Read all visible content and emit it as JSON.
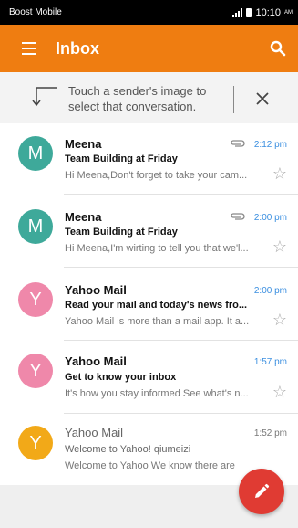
{
  "status_bar": {
    "carrier": "Boost Mobile",
    "time": "10:10",
    "ampm": "AM"
  },
  "app_bar": {
    "title": "Inbox"
  },
  "tip": {
    "text": "Touch a sender's image to select that conversation."
  },
  "colors": {
    "accent": "#ef7d11",
    "fab": "#e03b33",
    "unread_time": "#3b8fe0"
  },
  "messages": [
    {
      "initial": "M",
      "avatar_color": "#3ea99a",
      "sender": "Meena",
      "subject": "Team Building at Friday",
      "preview": "Hi Meena,Don't forget to take your cam...",
      "time": "2:12 pm",
      "attachment": true,
      "read": false
    },
    {
      "initial": "M",
      "avatar_color": "#3ea99a",
      "sender": "Meena",
      "subject": "Team Building at Friday",
      "preview": "Hi Meena,I'm wirting to tell you that we'l...",
      "time": "2:00 pm",
      "attachment": true,
      "read": false
    },
    {
      "initial": "Y",
      "avatar_color": "#ef88aa",
      "sender": "Yahoo Mail",
      "subject": "Read your mail and today's news fro...",
      "preview": "Yahoo Mail is more than a mail app. It a...",
      "time": "2:00 pm",
      "attachment": false,
      "read": false
    },
    {
      "initial": "Y",
      "avatar_color": "#ef88aa",
      "sender": "Yahoo Mail",
      "subject": "Get to know your inbox",
      "preview": "It's how you stay informed See what's n...",
      "time": "1:57 pm",
      "attachment": false,
      "read": false
    },
    {
      "initial": "Y",
      "avatar_color": "#f2a918",
      "sender": "Yahoo Mail",
      "subject": "Welcome to Yahoo! qiumeizi",
      "preview": "Welcome to Yahoo We know there are",
      "time": "1:52 pm",
      "attachment": false,
      "read": true
    }
  ]
}
